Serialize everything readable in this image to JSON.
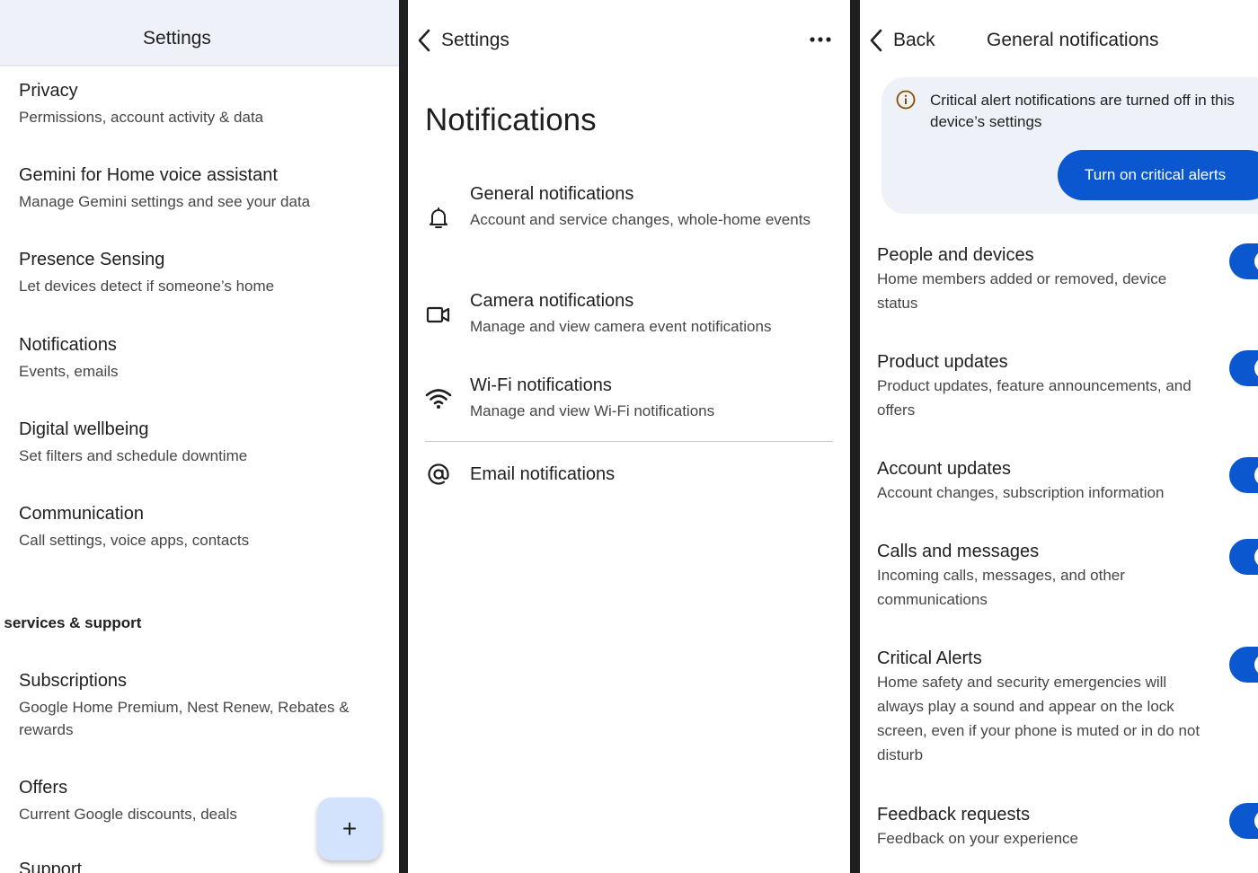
{
  "panel1": {
    "title": "Settings",
    "items": [
      {
        "title": "Privacy",
        "subtitle": "Permissions, account activity & data"
      },
      {
        "title": "Gemini for Home voice assistant",
        "subtitle": "Manage Gemini settings and see your data"
      },
      {
        "title": "Presence Sensing",
        "subtitle": "Let devices detect if someone’s home"
      },
      {
        "title": "Notifications",
        "subtitle": "Events, emails"
      },
      {
        "title": "Digital wellbeing",
        "subtitle": "Set filters and schedule downtime"
      },
      {
        "title": "Communication",
        "subtitle": "Call settings, voice apps, contacts"
      }
    ],
    "section_heading": "t services & support",
    "items2": [
      {
        "title": "Subscriptions",
        "subtitle": "Google Home Premium, Nest Renew, Rebates & rewards"
      },
      {
        "title": "Offers",
        "subtitle": "Current Google discounts, deals"
      },
      {
        "title": "Support",
        "subtitle": ""
      }
    ],
    "fab_label": "+",
    "fab_icon": "plus-icon"
  },
  "panel2": {
    "back_label": "Settings",
    "more_icon": "more-horizontal-icon",
    "heading": "Notifications",
    "items": [
      {
        "title": "General notifications",
        "subtitle": "Account and service changes, whole-home events",
        "icon": "bell-icon"
      },
      {
        "title": "Camera notifications",
        "subtitle": "Manage and view camera event notifications",
        "icon": "camera-icon"
      },
      {
        "title": "Wi-Fi notifications",
        "subtitle": "Manage and view Wi-Fi notifications",
        "icon": "wifi-icon"
      },
      {
        "title": "Email notifications",
        "subtitle": "",
        "icon": "at-sign-icon"
      }
    ]
  },
  "panel3": {
    "back_label": "Back",
    "title": "General notifications",
    "alert": {
      "text": "Critical alert notifications are turned off in this device’s settings",
      "button": "Turn on critical alerts",
      "icon": "info-icon"
    },
    "toggles": [
      {
        "title": "People and devices",
        "subtitle": "Home members added or removed, device status",
        "on": true
      },
      {
        "title": "Product updates",
        "subtitle": "Product updates, feature announcements, and offers",
        "on": true
      },
      {
        "title": "Account updates",
        "subtitle": "Account changes, subscription information",
        "on": true
      },
      {
        "title": "Calls and messages",
        "subtitle": "Incoming calls, messages, and other communications",
        "on": true
      },
      {
        "title": "Critical Alerts",
        "subtitle": "Home safety and security emergencies will always play a sound and appear on the lock screen, even if your phone is muted or in do not disturb",
        "on": true
      },
      {
        "title": "Feedback requests",
        "subtitle": "Feedback on your experience",
        "on": true
      }
    ]
  },
  "colors": {
    "accent": "#0b57d0",
    "header_bg": "#eef1f7",
    "card_bg": "#eef2f8",
    "fab_bg": "#d3e3fd",
    "divider": "#1f1f1f"
  }
}
